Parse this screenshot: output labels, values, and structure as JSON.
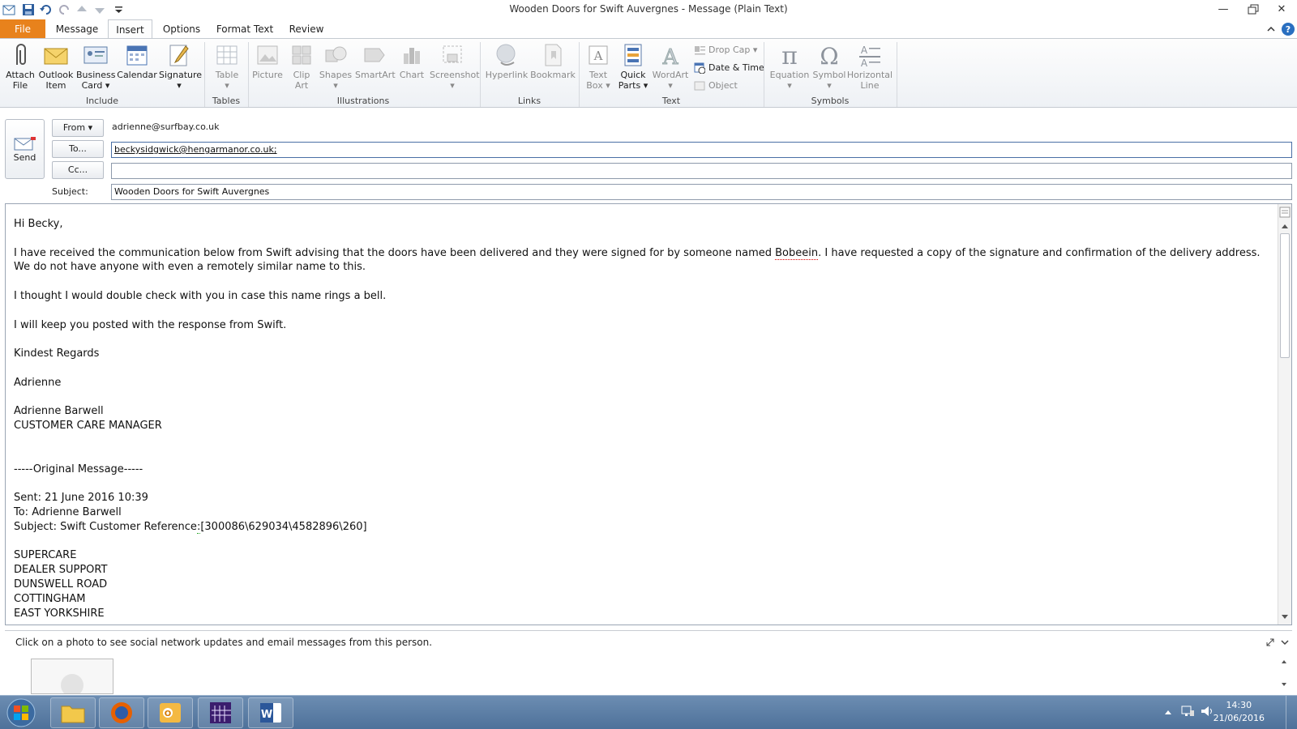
{
  "window": {
    "title": "Wooden Doors for Swift Auvergnes  -  Message (Plain Text)"
  },
  "tabs": {
    "file": "File",
    "message": "Message",
    "insert": "Insert",
    "options": "Options",
    "format_text": "Format Text",
    "review": "Review"
  },
  "ribbon": {
    "include": {
      "label": "Include",
      "attach_file": [
        "Attach",
        "File"
      ],
      "outlook_item": [
        "Outlook",
        "Item"
      ],
      "business_card": [
        "Business",
        "Card ▾"
      ],
      "calendar": "Calendar",
      "signature": [
        "Signature",
        "▾"
      ]
    },
    "tables": {
      "label": "Tables",
      "table": [
        "Table",
        "▾"
      ]
    },
    "illustrations": {
      "label": "Illustrations",
      "picture": "Picture",
      "clip_art": [
        "Clip",
        "Art"
      ],
      "shapes": [
        "Shapes",
        "▾"
      ],
      "smartart": "SmartArt",
      "chart": "Chart",
      "screenshot": [
        "Screenshot",
        "▾"
      ]
    },
    "links": {
      "label": "Links",
      "hyperlink": "Hyperlink",
      "bookmark": "Bookmark"
    },
    "text": {
      "label": "Text",
      "text_box": [
        "Text",
        "Box ▾"
      ],
      "quick_parts": [
        "Quick",
        "Parts ▾"
      ],
      "wordart": [
        "WordArt",
        "▾"
      ],
      "drop_cap": "Drop Cap ▾",
      "date_time": "Date & Time",
      "object": "Object"
    },
    "symbols": {
      "label": "Symbols",
      "equation": [
        "Equation",
        "▾"
      ],
      "symbol": [
        "Symbol",
        "▾"
      ],
      "horizontal_line": [
        "Horizontal",
        "Line"
      ]
    }
  },
  "header": {
    "send": "Send",
    "from_btn": "From ▾",
    "from_value": "adrienne@surfbay.co.uk",
    "to_btn": "To...",
    "to_value": "beckysidgwick@hengarmanor.co.uk;",
    "cc_btn": "Cc...",
    "cc_value": "",
    "subject_label": "Subject:",
    "subject_value": "Wooden Doors for Swift Auvergnes"
  },
  "body": {
    "greeting": "Hi Becky,",
    "para1_a": "I have received the communication below from Swift advising that the doors have been delivered and they were signed for by someone named ",
    "para1_name": "Bobeein",
    "para1_b": ".  I have requested a copy of the signature and confirmation of the delivery address.  We do not have anyone with even a remotely similar name to this.",
    "para2": "I thought I would double check with you in case this name rings a bell.",
    "para3": "I will keep you posted with the response from Swift.",
    "regards": "Kindest Regards",
    "name_short": "Adrienne",
    "name_full": "Adrienne Barwell",
    "job_title": "CUSTOMER CARE MANAGER",
    "orig_header": "-----Original Message-----",
    "sent": "Sent: 21 June 2016 10:39",
    "to": "To: Adrienne Barwell",
    "subject_a": "Subject: Swift Customer Reference",
    "subject_colon": ":",
    "subject_b": "[300086\\629034\\4582896\\260]",
    "addr1": "SUPERCARE",
    "addr2": "DEALER SUPPORT",
    "addr3": "DUNSWELL ROAD",
    "addr4": "COTTINGHAM",
    "addr5": "EAST YORKSHIRE"
  },
  "people_pane": {
    "text": "Click on a photo to see social network updates and email messages from this person."
  },
  "taskbar": {
    "time": "14:30",
    "date": "21/06/2016"
  },
  "colors": {
    "file_tab": "#e8821c",
    "taskbar": "#5a7ca4"
  }
}
